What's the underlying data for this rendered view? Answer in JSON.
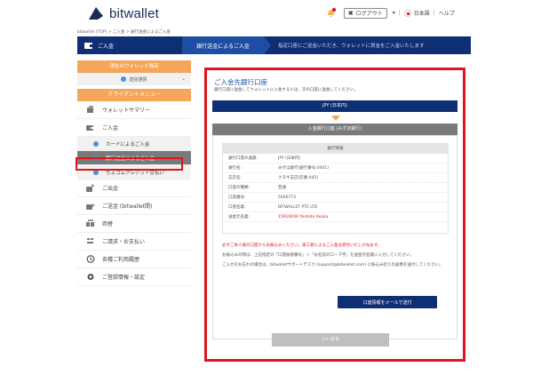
{
  "header": {
    "brand": "bitwallet",
    "login_label": "ログアウト",
    "language": "日本語",
    "help": "ヘルプ"
  },
  "breadcrumb": "bitwallet (TOP) > ご入金 > 銀行送金によるご入金",
  "steps": {
    "step1": "ご入金",
    "step2": "銀行送金によるご入金",
    "step3": "指定口座にご送金いただき、ウォレットに資金をご入金いたします"
  },
  "sidebar": {
    "wallet_head": "現在のウォレット残高",
    "wallet_select": "送信通貨",
    "menu_head": "クライアントメニュー",
    "items": [
      {
        "label": "ウォレットサマリー",
        "icon": "summary-icon"
      },
      {
        "label": "ご入金",
        "icon": "deposit-icon"
      },
      {
        "label": "カードによるご入金",
        "icon": "circle-icon"
      },
      {
        "label": "銀行送金によるご入金",
        "icon": "circle-icon"
      },
      {
        "label": "ちょコムクレジット受払い",
        "icon": "circle-icon"
      },
      {
        "label": "ご出金",
        "icon": "withdraw-icon"
      },
      {
        "label": "ご送金 (bitwallet間)",
        "icon": "transfer-icon"
      },
      {
        "label": "両替",
        "icon": "exchange-icon"
      },
      {
        "label": "ご請求・お支払い",
        "icon": "invoice-icon"
      },
      {
        "label": "各種ご利用履歴",
        "icon": "history-icon"
      },
      {
        "label": "ご登録情報・設定",
        "icon": "settings-icon"
      }
    ]
  },
  "main": {
    "title": "ご入金先銀行口座",
    "subtitle": "銀行口座に送金してウォレットに入金するには、次の口座に送金してください。",
    "currency_bar": "JPY (日本円)",
    "bank_bar": "入金銀行口座 (みずほ銀行)",
    "info_head": "銀行情報",
    "info_rows": [
      {
        "k": "銀行口座の通貨:",
        "v": "JPY (日本円)",
        "red": false
      },
      {
        "k": "銀行名:",
        "v": "みずほ銀行(銀行番号:0001)",
        "red": false
      },
      {
        "k": "支店名:",
        "v": "クヌギ支店(店番:045)",
        "red": false
      },
      {
        "k": "口座の種類:",
        "v": "普通",
        "red": false
      },
      {
        "k": "口座番号:",
        "v": "5406773",
        "red": false
      },
      {
        "k": "口座名義:",
        "v": "BITWALLET PTE LTD",
        "red": false
      },
      {
        "k": "送金元名義:",
        "v": "15916039 Yoshida Asuka",
        "red": true
      }
    ],
    "note_red": "必ずご本人様の口座からお振込みください。第三者によるご入金は受付いたしかねます。",
    "note1": "お振込みの際は、上記指定の「口座振替番号」＋「お名前のローマ字」を送金元名義に入力してください。",
    "note2": "ご入力をお忘れの場合は、bitwalletサポートデスク (support@bitwallet.com) に振込み控えの画像を送付してください。",
    "mail_button": "口座情報をメールで送付",
    "back_button": "<< 戻る"
  },
  "colors": {
    "navy": "#0f2f74",
    "orange": "#f5a65b",
    "highlight_red": "#e0141e"
  }
}
